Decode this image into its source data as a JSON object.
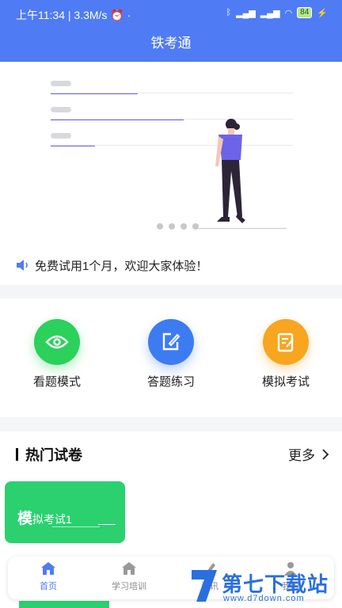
{
  "status_bar": {
    "time": "上午11:34",
    "speed": "| 3.3M/s",
    "battery": "84"
  },
  "header": {
    "title": "铁考通"
  },
  "notice": {
    "text": "免费试用1个月，欢迎大家体验！"
  },
  "modes": [
    {
      "label": "看题模式",
      "icon": "eye-icon",
      "color": "#2bd15a"
    },
    {
      "label": "答题练习",
      "icon": "edit-icon",
      "color": "#3d7bf2"
    },
    {
      "label": "模拟考试",
      "icon": "exam-icon",
      "color": "#f8a51f"
    }
  ],
  "hot": {
    "title": "热门试卷",
    "more": "更多",
    "card": {
      "title_big": "模",
      "title_rest": "拟考试1"
    }
  },
  "tabs": [
    {
      "label": "首页",
      "icon": "home-icon",
      "active": true
    },
    {
      "label": "学习培训",
      "icon": "home-icon",
      "active": false
    },
    {
      "label": "资讯",
      "icon": "news-icon",
      "active": false
    },
    {
      "label": "我的",
      "icon": "user-icon",
      "active": false
    }
  ],
  "watermark": {
    "title": "第七下载站",
    "url": "www.d7down.com"
  },
  "colors": {
    "primary": "#4f7bf4",
    "green": "#2bd06f",
    "purple": "#6c63e8"
  }
}
